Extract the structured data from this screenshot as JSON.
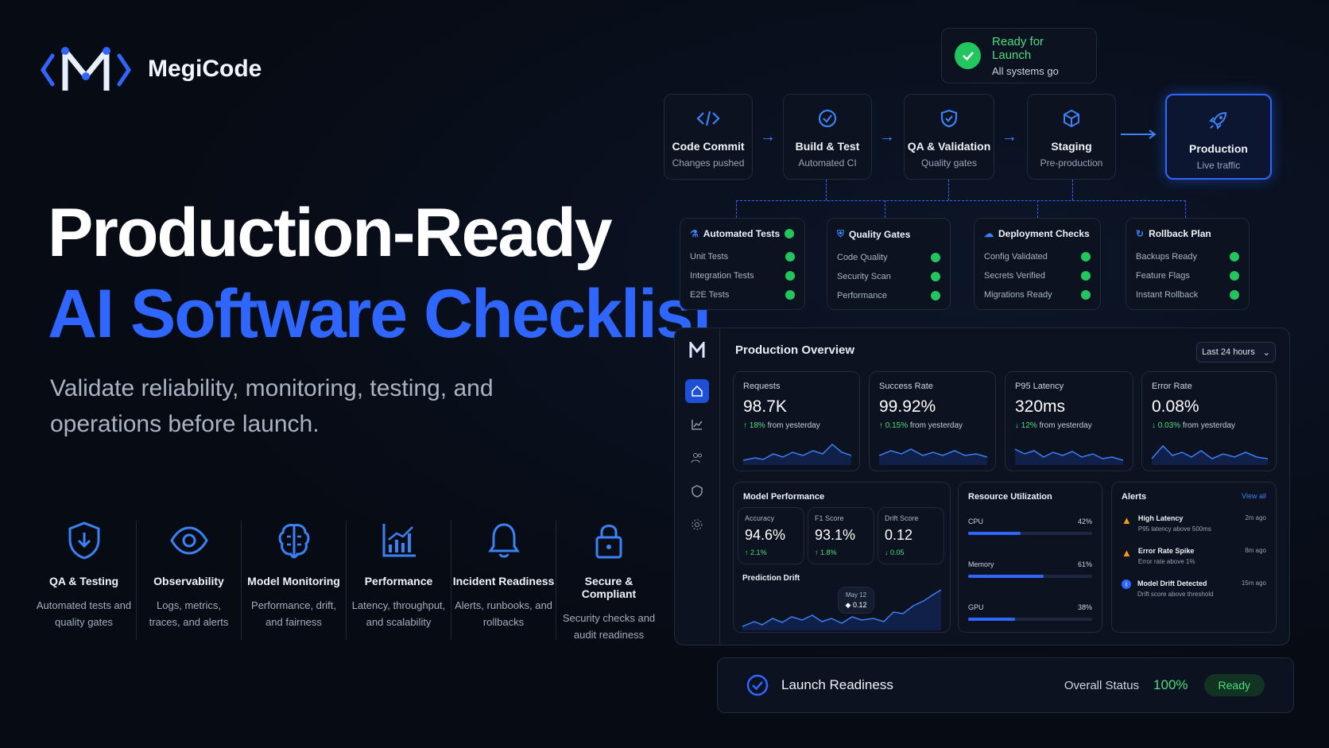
{
  "brand": {
    "name": "MegiCode"
  },
  "hero": {
    "title_line1": "Production-Ready",
    "title_line2": "AI Software Checklist",
    "subtitle": "Validate reliability, monitoring, testing, and operations before launch."
  },
  "features": [
    {
      "icon": "shield-download-icon",
      "title": "QA & Testing",
      "desc": "Automated tests and quality gates"
    },
    {
      "icon": "eye-icon",
      "title": "Observability",
      "desc": "Logs, metrics, traces, and alerts"
    },
    {
      "icon": "brain-icon",
      "title": "Model Monitoring",
      "desc": "Performance, drift, and fairness"
    },
    {
      "icon": "chart-icon",
      "title": "Performance",
      "desc": "Latency, throughput, and scalability"
    },
    {
      "icon": "bell-icon",
      "title": "Incident Readiness",
      "desc": "Alerts, runbooks, and rollbacks"
    },
    {
      "icon": "lock-icon",
      "title": "Secure & Compliant",
      "desc": "Security checks and audit readiness"
    }
  ],
  "launch_badge": {
    "title": "Ready for Launch",
    "subtitle": "All systems go"
  },
  "pipeline": [
    {
      "icon": "code-icon",
      "title": "Code Commit",
      "desc": "Changes pushed"
    },
    {
      "icon": "check-circle-icon",
      "title": "Build & Test",
      "desc": "Automated CI"
    },
    {
      "icon": "shield-check-icon",
      "title": "QA & Validation",
      "desc": "Quality gates"
    },
    {
      "icon": "cube-icon",
      "title": "Staging",
      "desc": "Pre-production"
    },
    {
      "icon": "rocket-icon",
      "title": "Production",
      "desc": "Live traffic"
    }
  ],
  "checklists": [
    {
      "title": "Automated Tests",
      "items": [
        "Unit Tests",
        "Integration Tests",
        "E2E Tests"
      ]
    },
    {
      "title": "Quality Gates",
      "items": [
        "Code Quality",
        "Security Scan",
        "Performance"
      ]
    },
    {
      "title": "Deployment Checks",
      "items": [
        "Config Validated",
        "Secrets Verified",
        "Migrations Ready"
      ]
    },
    {
      "title": "Rollback Plan",
      "items": [
        "Backups Ready",
        "Feature Flags",
        "Instant Rollback"
      ]
    }
  ],
  "dashboard": {
    "title": "Production Overview",
    "range": "Last 24 hours",
    "kpis": [
      {
        "label": "Requests",
        "value": "98.7K",
        "delta": "↑ 18%",
        "suffix": "from yesterday"
      },
      {
        "label": "Success Rate",
        "value": "99.92%",
        "delta": "↑ 0.15%",
        "suffix": "from yesterday"
      },
      {
        "label": "P95 Latency",
        "value": "320ms",
        "delta": "↓ 12%",
        "suffix": "from yesterday"
      },
      {
        "label": "Error Rate",
        "value": "0.08%",
        "delta": "↓ 0.03%",
        "suffix": "from yesterday"
      }
    ],
    "model_performance": {
      "title": "Model Performance",
      "metrics": [
        {
          "label": "Accuracy",
          "value": "94.6%",
          "delta": "↑ 2.1%"
        },
        {
          "label": "F1 Score",
          "value": "93.1%",
          "delta": "↑ 1.8%"
        },
        {
          "label": "Drift Score",
          "value": "0.12",
          "delta": "↓ 0.05"
        }
      ],
      "drift_title": "Prediction Drift",
      "tooltip_date": "May 12",
      "tooltip_value": "◆ 0.12"
    },
    "resources": {
      "title": "Resource Utilization",
      "items": [
        {
          "label": "CPU",
          "value": "42%",
          "level": 0.42
        },
        {
          "label": "Memory",
          "value": "61%",
          "level": 0.61
        },
        {
          "label": "GPU",
          "value": "38%",
          "level": 0.38
        }
      ]
    },
    "alerts": {
      "title": "Alerts",
      "view_all": "View all",
      "items": [
        {
          "title": "High Latency",
          "desc": "P95 latency above 500ms",
          "time": "2m ago",
          "level": "warning"
        },
        {
          "title": "Error Rate Spike",
          "desc": "Error rate above 1%",
          "time": "8m ago",
          "level": "warning"
        },
        {
          "title": "Model Drift Detected",
          "desc": "Drift score above threshold",
          "time": "15m ago",
          "level": "info"
        }
      ]
    }
  },
  "launch": {
    "title": "Launch Readiness",
    "status_label": "Overall Status",
    "percent": "100%",
    "badge": "Ready"
  },
  "colors": {
    "accent": "#2f66ff",
    "success": "#22c55e",
    "bg": "#070b14"
  }
}
